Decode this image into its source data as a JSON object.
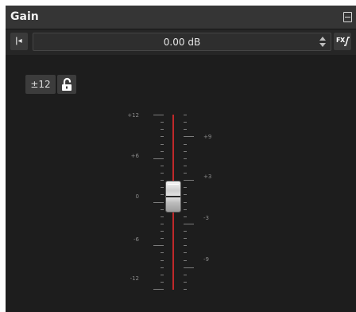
{
  "panel": {
    "title": "Gain"
  },
  "toolbar": {
    "value": "0.00 dB",
    "fx_label": "FX",
    "icons": [
      "reset-to-start-icon",
      "spin-up-icon",
      "spin-down-icon",
      "fx-curve-icon",
      "collapse-icon"
    ]
  },
  "controls": {
    "range_label": "±12",
    "lock_state": "unlocked",
    "lock_icon": "unlocked-padlock-icon"
  },
  "fader": {
    "value_db": 0.0,
    "min_db": -12,
    "max_db": 12,
    "track_color": "#c0282a",
    "left_scale": [
      "+12",
      "+6",
      "0",
      "-6",
      "-12"
    ],
    "right_scale": [
      "+9",
      "+3",
      "-3",
      "-9"
    ]
  }
}
